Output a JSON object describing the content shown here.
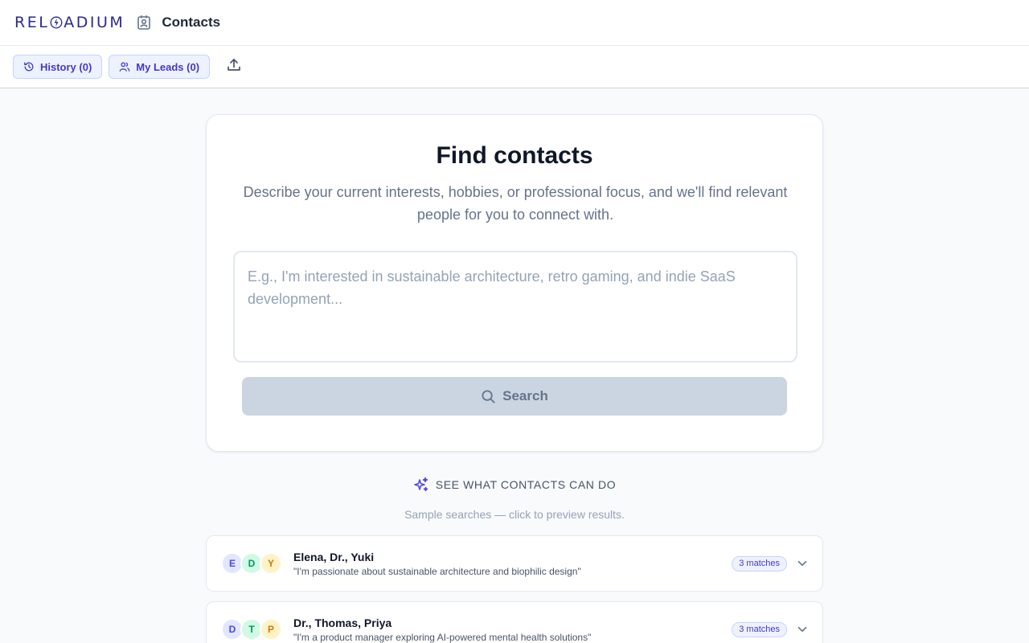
{
  "header": {
    "logo_left": "REL",
    "logo_right": "ADIUM",
    "title": "Contacts"
  },
  "toolbar": {
    "history_label": "History (0)",
    "leads_label": "My Leads (0)"
  },
  "finder": {
    "title": "Find contacts",
    "description": "Describe your current interests, hobbies, or professional focus, and we'll find relevant people for you to connect with.",
    "placeholder": "E.g., I'm interested in sustainable architecture, retro gaming, and indie SaaS development...",
    "value": "",
    "search_label": "Search"
  },
  "samples_section": {
    "heading": "SEE WHAT CONTACTS CAN DO",
    "note": "Sample searches — click to preview results."
  },
  "samples": [
    {
      "names": "Elena, Dr., Yuki",
      "quote": "\"I'm passionate about sustainable architecture and biophilic design\"",
      "badge": "3 matches",
      "avatars": [
        {
          "letter": "E",
          "bg": "#e0e7ff",
          "fg": "#4f46e5"
        },
        {
          "letter": "D",
          "bg": "#d1fae5",
          "fg": "#059669"
        },
        {
          "letter": "Y",
          "bg": "#fef3c7",
          "fg": "#d97706"
        }
      ]
    },
    {
      "names": "Dr., Thomas, Priya",
      "quote": "\"I'm a product manager exploring AI-powered mental health solutions\"",
      "badge": "3 matches",
      "avatars": [
        {
          "letter": "D",
          "bg": "#e0e7ff",
          "fg": "#4f46e5"
        },
        {
          "letter": "T",
          "bg": "#d1fae5",
          "fg": "#059669"
        },
        {
          "letter": "P",
          "bg": "#fef3c7",
          "fg": "#d97706"
        }
      ]
    }
  ],
  "colors": {
    "brand": "#2b2a8f",
    "accent": "#4338ca",
    "button_disabled": "#cbd5e1",
    "background": "#f8fafc"
  },
  "icons": [
    "bolt-o-icon",
    "contact-badge-icon",
    "history-icon",
    "users-icon",
    "upload-icon",
    "search-icon",
    "sparkles-icon",
    "chevron-down-icon"
  ]
}
